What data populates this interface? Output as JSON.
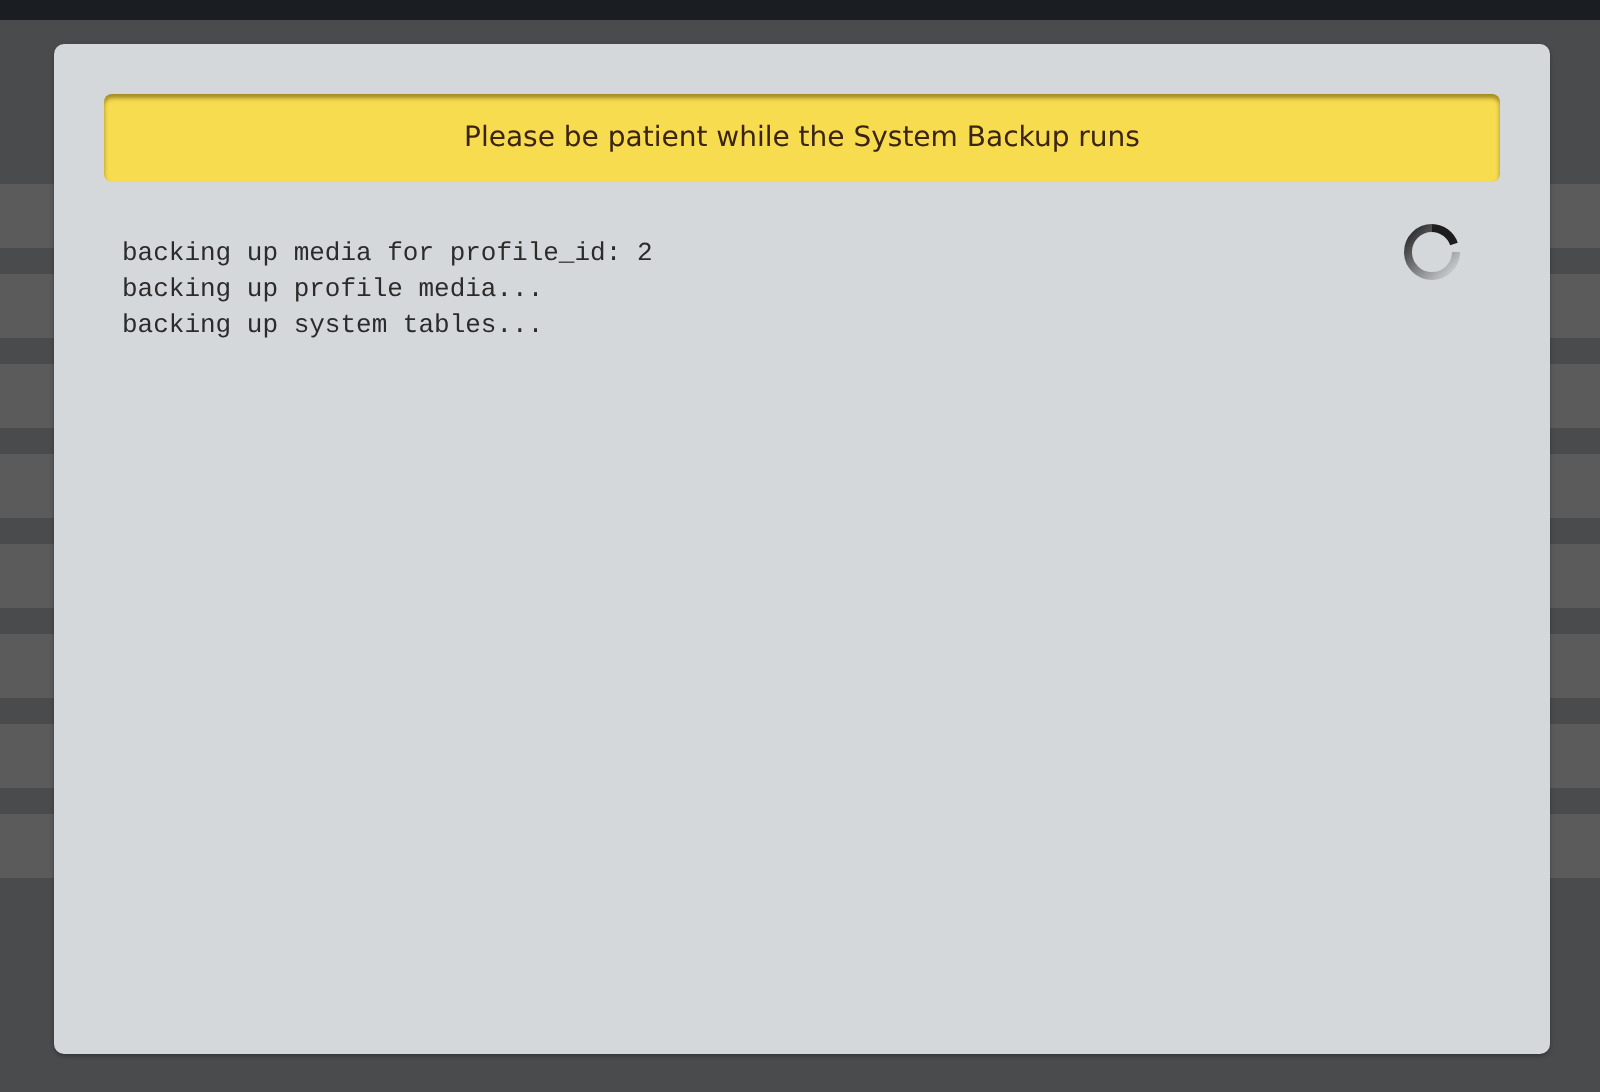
{
  "dialog": {
    "banner": "Please be patient while the System Backup runs",
    "log_lines": [
      "backing up media for profile_id: 2",
      "backing up profile media...",
      "backing up system tables..."
    ]
  }
}
